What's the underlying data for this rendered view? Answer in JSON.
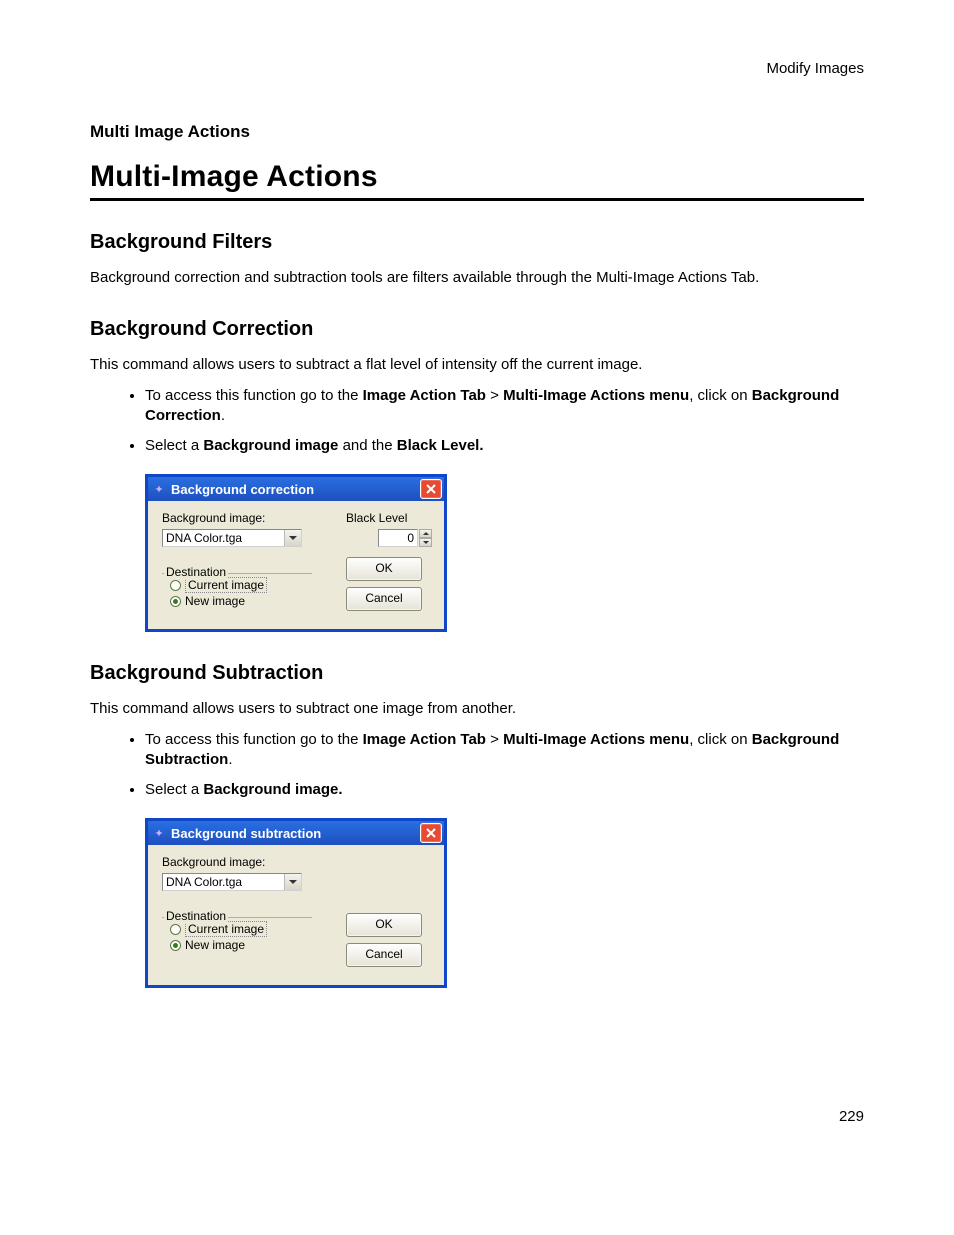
{
  "header": {
    "right": "Modify Images"
  },
  "section_label": "Multi Image Actions",
  "main_title": "Multi-Image Actions",
  "h_bg_filters": "Background Filters",
  "p_bg_filters": "Background correction and subtraction tools are filters available through the Multi-Image Actions Tab.",
  "h_bg_corr": "Background Correction",
  "p_bg_corr": "This command allows users to subtract a flat level of intensity off the current image.",
  "bc_bullets": {
    "b1_pre": "To access this function go to the ",
    "b1_bold1": "Image Action Tab",
    "b1_gt": " > ",
    "b1_bold2": "Multi-Image Actions menu",
    "b1_mid": ", click on ",
    "b1_bold3": "Background Correction",
    "b1_end": ".",
    "b2_pre": "Select a ",
    "b2_bold1": "Background image",
    "b2_mid": " and the ",
    "b2_bold2": "Black Level."
  },
  "dialog_bc": {
    "title": "Background correction",
    "lbl_bgimg": "Background image:",
    "combo_value": "DNA Color.tga",
    "lbl_black": "Black Level",
    "black_value": "0",
    "gb_title": "Destination",
    "radio_current": "Current image",
    "radio_new": "New image",
    "btn_ok": "OK",
    "btn_cancel": "Cancel"
  },
  "h_bg_sub": "Background Subtraction",
  "p_bg_sub": "This command allows users to subtract one image from another.",
  "bs_bullets": {
    "b1_pre": "To access this function go to the ",
    "b1_bold1": "Image Action Tab",
    "b1_gt": " > ",
    "b1_bold2": "Multi-Image Actions menu",
    "b1_mid": ", click on ",
    "b1_bold3": "Background Subtraction",
    "b1_end": ".",
    "b2_pre": "Select a ",
    "b2_bold1": "Background image."
  },
  "dialog_bs": {
    "title": "Background subtraction",
    "lbl_bgimg": "Background image:",
    "combo_value": "DNA Color.tga",
    "gb_title": "Destination",
    "radio_current": "Current image",
    "radio_new": "New image",
    "btn_ok": "OK",
    "btn_cancel": "Cancel"
  },
  "page_number": "229"
}
